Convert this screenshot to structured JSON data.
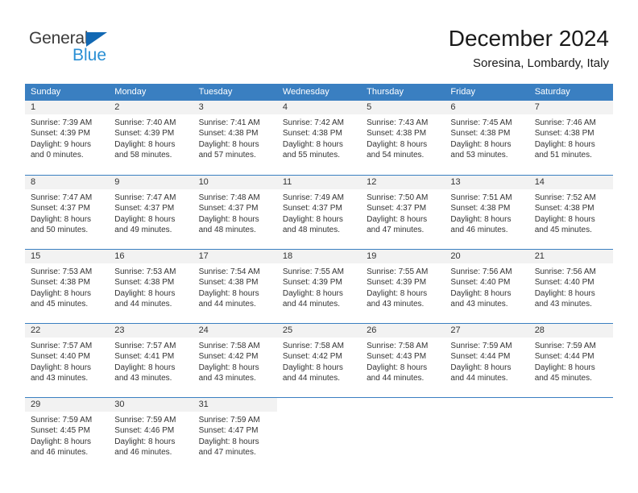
{
  "logo": {
    "word_general": "General",
    "word_blue": "Blue",
    "triangle_color": "#1268b3",
    "blue_color": "#2a8fd4"
  },
  "header": {
    "title": "December 2024",
    "subtitle": "Soresina, Lombardy, Italy"
  },
  "theme": {
    "header_blue": "#3a7fc1",
    "daynum_band": "#f2f2f2",
    "text": "#333333"
  },
  "weekdays": [
    "Sunday",
    "Monday",
    "Tuesday",
    "Wednesday",
    "Thursday",
    "Friday",
    "Saturday"
  ],
  "weeks": [
    [
      {
        "day": "1",
        "sunrise": "Sunrise: 7:39 AM",
        "sunset": "Sunset: 4:39 PM",
        "daylight1": "Daylight: 9 hours",
        "daylight2": "and 0 minutes."
      },
      {
        "day": "2",
        "sunrise": "Sunrise: 7:40 AM",
        "sunset": "Sunset: 4:39 PM",
        "daylight1": "Daylight: 8 hours",
        "daylight2": "and 58 minutes."
      },
      {
        "day": "3",
        "sunrise": "Sunrise: 7:41 AM",
        "sunset": "Sunset: 4:38 PM",
        "daylight1": "Daylight: 8 hours",
        "daylight2": "and 57 minutes."
      },
      {
        "day": "4",
        "sunrise": "Sunrise: 7:42 AM",
        "sunset": "Sunset: 4:38 PM",
        "daylight1": "Daylight: 8 hours",
        "daylight2": "and 55 minutes."
      },
      {
        "day": "5",
        "sunrise": "Sunrise: 7:43 AM",
        "sunset": "Sunset: 4:38 PM",
        "daylight1": "Daylight: 8 hours",
        "daylight2": "and 54 minutes."
      },
      {
        "day": "6",
        "sunrise": "Sunrise: 7:45 AM",
        "sunset": "Sunset: 4:38 PM",
        "daylight1": "Daylight: 8 hours",
        "daylight2": "and 53 minutes."
      },
      {
        "day": "7",
        "sunrise": "Sunrise: 7:46 AM",
        "sunset": "Sunset: 4:38 PM",
        "daylight1": "Daylight: 8 hours",
        "daylight2": "and 51 minutes."
      }
    ],
    [
      {
        "day": "8",
        "sunrise": "Sunrise: 7:47 AM",
        "sunset": "Sunset: 4:37 PM",
        "daylight1": "Daylight: 8 hours",
        "daylight2": "and 50 minutes."
      },
      {
        "day": "9",
        "sunrise": "Sunrise: 7:47 AM",
        "sunset": "Sunset: 4:37 PM",
        "daylight1": "Daylight: 8 hours",
        "daylight2": "and 49 minutes."
      },
      {
        "day": "10",
        "sunrise": "Sunrise: 7:48 AM",
        "sunset": "Sunset: 4:37 PM",
        "daylight1": "Daylight: 8 hours",
        "daylight2": "and 48 minutes."
      },
      {
        "day": "11",
        "sunrise": "Sunrise: 7:49 AM",
        "sunset": "Sunset: 4:37 PM",
        "daylight1": "Daylight: 8 hours",
        "daylight2": "and 48 minutes."
      },
      {
        "day": "12",
        "sunrise": "Sunrise: 7:50 AM",
        "sunset": "Sunset: 4:37 PM",
        "daylight1": "Daylight: 8 hours",
        "daylight2": "and 47 minutes."
      },
      {
        "day": "13",
        "sunrise": "Sunrise: 7:51 AM",
        "sunset": "Sunset: 4:38 PM",
        "daylight1": "Daylight: 8 hours",
        "daylight2": "and 46 minutes."
      },
      {
        "day": "14",
        "sunrise": "Sunrise: 7:52 AM",
        "sunset": "Sunset: 4:38 PM",
        "daylight1": "Daylight: 8 hours",
        "daylight2": "and 45 minutes."
      }
    ],
    [
      {
        "day": "15",
        "sunrise": "Sunrise: 7:53 AM",
        "sunset": "Sunset: 4:38 PM",
        "daylight1": "Daylight: 8 hours",
        "daylight2": "and 45 minutes."
      },
      {
        "day": "16",
        "sunrise": "Sunrise: 7:53 AM",
        "sunset": "Sunset: 4:38 PM",
        "daylight1": "Daylight: 8 hours",
        "daylight2": "and 44 minutes."
      },
      {
        "day": "17",
        "sunrise": "Sunrise: 7:54 AM",
        "sunset": "Sunset: 4:38 PM",
        "daylight1": "Daylight: 8 hours",
        "daylight2": "and 44 minutes."
      },
      {
        "day": "18",
        "sunrise": "Sunrise: 7:55 AM",
        "sunset": "Sunset: 4:39 PM",
        "daylight1": "Daylight: 8 hours",
        "daylight2": "and 44 minutes."
      },
      {
        "day": "19",
        "sunrise": "Sunrise: 7:55 AM",
        "sunset": "Sunset: 4:39 PM",
        "daylight1": "Daylight: 8 hours",
        "daylight2": "and 43 minutes."
      },
      {
        "day": "20",
        "sunrise": "Sunrise: 7:56 AM",
        "sunset": "Sunset: 4:40 PM",
        "daylight1": "Daylight: 8 hours",
        "daylight2": "and 43 minutes."
      },
      {
        "day": "21",
        "sunrise": "Sunrise: 7:56 AM",
        "sunset": "Sunset: 4:40 PM",
        "daylight1": "Daylight: 8 hours",
        "daylight2": "and 43 minutes."
      }
    ],
    [
      {
        "day": "22",
        "sunrise": "Sunrise: 7:57 AM",
        "sunset": "Sunset: 4:40 PM",
        "daylight1": "Daylight: 8 hours",
        "daylight2": "and 43 minutes."
      },
      {
        "day": "23",
        "sunrise": "Sunrise: 7:57 AM",
        "sunset": "Sunset: 4:41 PM",
        "daylight1": "Daylight: 8 hours",
        "daylight2": "and 43 minutes."
      },
      {
        "day": "24",
        "sunrise": "Sunrise: 7:58 AM",
        "sunset": "Sunset: 4:42 PM",
        "daylight1": "Daylight: 8 hours",
        "daylight2": "and 43 minutes."
      },
      {
        "day": "25",
        "sunrise": "Sunrise: 7:58 AM",
        "sunset": "Sunset: 4:42 PM",
        "daylight1": "Daylight: 8 hours",
        "daylight2": "and 44 minutes."
      },
      {
        "day": "26",
        "sunrise": "Sunrise: 7:58 AM",
        "sunset": "Sunset: 4:43 PM",
        "daylight1": "Daylight: 8 hours",
        "daylight2": "and 44 minutes."
      },
      {
        "day": "27",
        "sunrise": "Sunrise: 7:59 AM",
        "sunset": "Sunset: 4:44 PM",
        "daylight1": "Daylight: 8 hours",
        "daylight2": "and 44 minutes."
      },
      {
        "day": "28",
        "sunrise": "Sunrise: 7:59 AM",
        "sunset": "Sunset: 4:44 PM",
        "daylight1": "Daylight: 8 hours",
        "daylight2": "and 45 minutes."
      }
    ],
    [
      {
        "day": "29",
        "sunrise": "Sunrise: 7:59 AM",
        "sunset": "Sunset: 4:45 PM",
        "daylight1": "Daylight: 8 hours",
        "daylight2": "and 46 minutes."
      },
      {
        "day": "30",
        "sunrise": "Sunrise: 7:59 AM",
        "sunset": "Sunset: 4:46 PM",
        "daylight1": "Daylight: 8 hours",
        "daylight2": "and 46 minutes."
      },
      {
        "day": "31",
        "sunrise": "Sunrise: 7:59 AM",
        "sunset": "Sunset: 4:47 PM",
        "daylight1": "Daylight: 8 hours",
        "daylight2": "and 47 minutes."
      },
      {
        "day": "",
        "sunrise": "",
        "sunset": "",
        "daylight1": "",
        "daylight2": ""
      },
      {
        "day": "",
        "sunrise": "",
        "sunset": "",
        "daylight1": "",
        "daylight2": ""
      },
      {
        "day": "",
        "sunrise": "",
        "sunset": "",
        "daylight1": "",
        "daylight2": ""
      },
      {
        "day": "",
        "sunrise": "",
        "sunset": "",
        "daylight1": "",
        "daylight2": ""
      }
    ]
  ]
}
